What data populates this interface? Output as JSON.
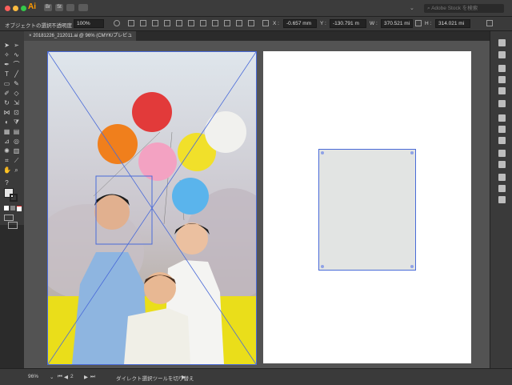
{
  "app": {
    "logo": "Ai"
  },
  "titlebar": {
    "buttons": [
      "Br",
      "St"
    ],
    "stock_search": "Adobe Stock を検索"
  },
  "control_bar": {
    "selection_label": "オブジェクトの選択",
    "opacity_label": "不透明度 :",
    "opacity_value": "100%",
    "x_label": "X :",
    "x_value": "-0.657 mm",
    "y_label": "Y :",
    "y_value": "-130.791 m",
    "w_label": "W :",
    "w_value": "370.521 mi",
    "h_label": "H :",
    "h_value": "314.021 mi"
  },
  "document_tab": {
    "close": "×",
    "title": "20181226_212011.ai @ 96% (CMYK/プレビュー)"
  },
  "status_bar": {
    "zoom": "96%",
    "page": "2",
    "tool_hint": "ダイレクト選択ツールを切り替え"
  },
  "colors": {
    "accent": "#4a6bd8",
    "canvas_bg": "#535353",
    "panel_bg": "#3a3a3a",
    "app_logo": "#ff9a00"
  },
  "icons": [
    "selection-tool-icon",
    "direct-selection-icon",
    "pen-icon",
    "type-icon",
    "rectangle-icon",
    "brush-icon",
    "zoom-icon",
    "hand-icon"
  ]
}
